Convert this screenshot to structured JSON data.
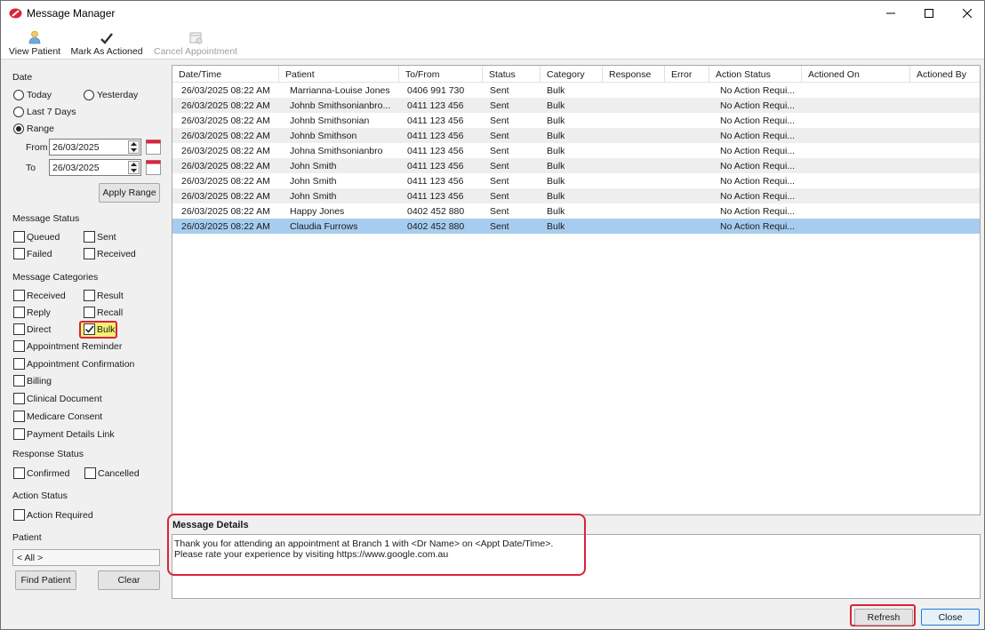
{
  "window": {
    "title": "Message Manager",
    "brand_color": "#d9243a"
  },
  "toolbar": {
    "view_patient": "View Patient",
    "mark_as_actioned": "Mark As Actioned",
    "cancel_appointment": "Cancel Appointment"
  },
  "filters": {
    "date": {
      "heading": "Date",
      "today": "Today",
      "yesterday": "Yesterday",
      "last7": "Last 7 Days",
      "range": "Range",
      "selected": "Range",
      "from_label": "From",
      "from_value": "26/03/2025",
      "to_label": "To",
      "to_value": "26/03/2025",
      "apply_range": "Apply Range"
    },
    "message_status": {
      "heading": "Message Status",
      "queued": "Queued",
      "sent": "Sent",
      "failed": "Failed",
      "received": "Received"
    },
    "message_categories": {
      "heading": "Message Categories",
      "received": "Received",
      "result": "Result",
      "reply": "Reply",
      "recall": "Recall",
      "direct": "Direct",
      "bulk": "Bulk",
      "bulk_checked": true,
      "appointment_reminder": "Appointment Reminder",
      "appointment_confirmation": "Appointment Confirmation",
      "billing": "Billing",
      "clinical_document": "Clinical Document",
      "medicare_consent": "Medicare Consent",
      "payment_details_link": "Payment Details Link"
    },
    "response_status": {
      "heading": "Response Status",
      "confirmed": "Confirmed",
      "cancelled": "Cancelled"
    },
    "action_status": {
      "heading": "Action Status",
      "action_required": "Action Required"
    },
    "patient": {
      "heading": "Patient",
      "value": "< All >",
      "find_patient": "Find Patient",
      "clear": "Clear"
    }
  },
  "grid": {
    "columns": [
      "Date/Time",
      "Patient",
      "To/From",
      "Status",
      "Category",
      "Response",
      "Error",
      "Action Status",
      "Actioned On",
      "Actioned By"
    ],
    "rows": [
      [
        "26/03/2025 08:22 AM",
        "Marrianna-Louise Jones",
        "0406 991 730",
        "Sent",
        "Bulk",
        "",
        "",
        "No Action Requi...",
        "",
        ""
      ],
      [
        "26/03/2025 08:22 AM",
        "Johnb Smithsonianbro...",
        "0411 123 456",
        "Sent",
        "Bulk",
        "",
        "",
        "No Action Requi...",
        "",
        ""
      ],
      [
        "26/03/2025 08:22 AM",
        "Johnb Smithsonian",
        "0411 123 456",
        "Sent",
        "Bulk",
        "",
        "",
        "No Action Requi...",
        "",
        ""
      ],
      [
        "26/03/2025 08:22 AM",
        "Johnb Smithson",
        "0411 123 456",
        "Sent",
        "Bulk",
        "",
        "",
        "No Action Requi...",
        "",
        ""
      ],
      [
        "26/03/2025 08:22 AM",
        "Johna Smithsonianbro",
        "0411 123 456",
        "Sent",
        "Bulk",
        "",
        "",
        "No Action Requi...",
        "",
        ""
      ],
      [
        "26/03/2025 08:22 AM",
        "John Smith",
        "0411 123 456",
        "Sent",
        "Bulk",
        "",
        "",
        "No Action Requi...",
        "",
        ""
      ],
      [
        "26/03/2025 08:22 AM",
        "John Smith",
        "0411 123 456",
        "Sent",
        "Bulk",
        "",
        "",
        "No Action Requi...",
        "",
        ""
      ],
      [
        "26/03/2025 08:22 AM",
        "John Smith",
        "0411 123 456",
        "Sent",
        "Bulk",
        "",
        "",
        "No Action Requi...",
        "",
        ""
      ],
      [
        "26/03/2025 08:22 AM",
        "Happy Jones",
        "0402 452 880",
        "Sent",
        "Bulk",
        "",
        "",
        "No Action Requi...",
        "",
        ""
      ],
      [
        "26/03/2025 08:22 AM",
        "Claudia Furrows",
        "0402 452 880",
        "Sent",
        "Bulk",
        "",
        "",
        "No Action Requi...",
        "",
        ""
      ]
    ],
    "selected_row": 9
  },
  "details": {
    "heading": "Message Details",
    "line1": "Thank you for attending an appointment at Branch 1 with <Dr Name> on <Appt Date/Time>.",
    "line2": "Please rate your experience by visiting https://www.google.com.au"
  },
  "footer": {
    "refresh": "Refresh",
    "close": "Close"
  }
}
